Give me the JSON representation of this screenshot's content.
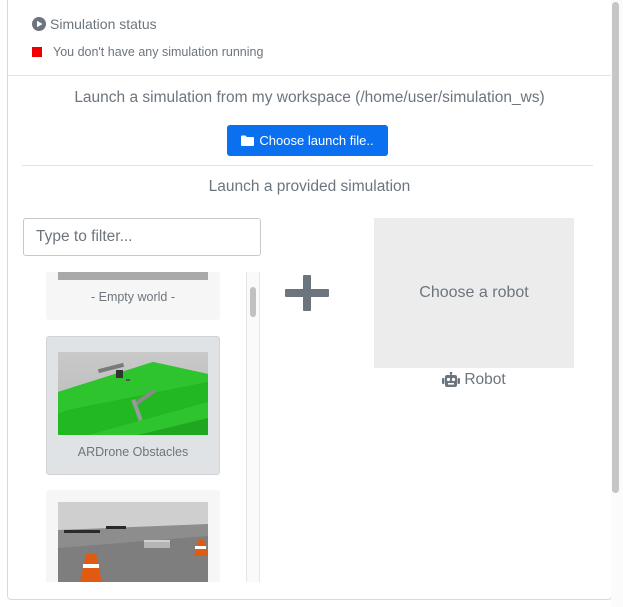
{
  "status": {
    "header_icon": "play-circle-icon",
    "header": "Simulation status",
    "indicator_color": "#ee0000",
    "message": "You don't have any simulation running"
  },
  "workspace": {
    "heading": "Launch a simulation from my workspace (/home/user/simulation_ws)",
    "button_icon": "folder-icon",
    "button_label": "Choose launch file.."
  },
  "provided": {
    "heading": "Launch a provided simulation",
    "filter_placeholder": "Type to filter...",
    "worlds": [
      {
        "label": "- Empty world -",
        "selected": false
      },
      {
        "label": "ARDrone Obstacles",
        "selected": true
      },
      {
        "label": "",
        "selected": false
      }
    ]
  },
  "robot": {
    "box_label": "Choose a robot",
    "caption_icon": "robot-icon",
    "caption": "Robot"
  },
  "colors": {
    "primary": "#0a70f0",
    "muted_text": "#6c757d",
    "selected_card": "#dfe3e6"
  }
}
